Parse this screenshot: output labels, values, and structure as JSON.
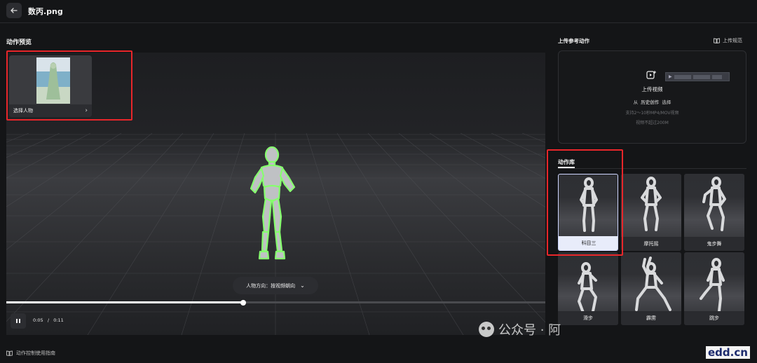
{
  "header": {
    "back_icon": "arrow-left-icon",
    "title": "数丙.png"
  },
  "left_panel": {
    "section_title": "动作预览",
    "character_card": {
      "label": "选择人物",
      "chevron_icon": "chevron-right-icon"
    },
    "direction_selector": {
      "label": "人物方向：按视频朝向",
      "icon": "chevron-down-icon"
    },
    "playback": {
      "progress": 0.44,
      "current_time": "0:05",
      "separator": "/",
      "total_time": "0:11",
      "pause_icon": "pause-icon"
    },
    "footer_link": {
      "label": "动作控制使用指南",
      "icon": "book-icon"
    }
  },
  "right_panel": {
    "section_title": "上传参考动作",
    "spec_link": {
      "label": "上传规范",
      "icon": "book-icon"
    },
    "upload": {
      "icon": "video-upload-icon",
      "label": "上传视频",
      "from_prefix": "从",
      "from_link": "历史创作",
      "from_suffix": "选择",
      "note1": "支持2～10秒MP4/MOV视频",
      "note2": "视频不超过200M"
    },
    "library": {
      "tab_label": "动作库",
      "items": [
        {
          "label": "科目三",
          "selected": true
        },
        {
          "label": "摩托摇",
          "selected": false
        },
        {
          "label": "鬼步舞",
          "selected": false
        },
        {
          "label": "滑步",
          "selected": false
        },
        {
          "label": "霹雳",
          "selected": false
        },
        {
          "label": "跳步",
          "selected": false
        }
      ]
    }
  },
  "watermark": {
    "text": "公众号 · 阿",
    "site": "edd.cn"
  },
  "colors": {
    "background": "#141517",
    "highlight_box": "#e8262a",
    "figure_outline": "#7dff6a",
    "selected_card_label": "#e8ecfa"
  }
}
